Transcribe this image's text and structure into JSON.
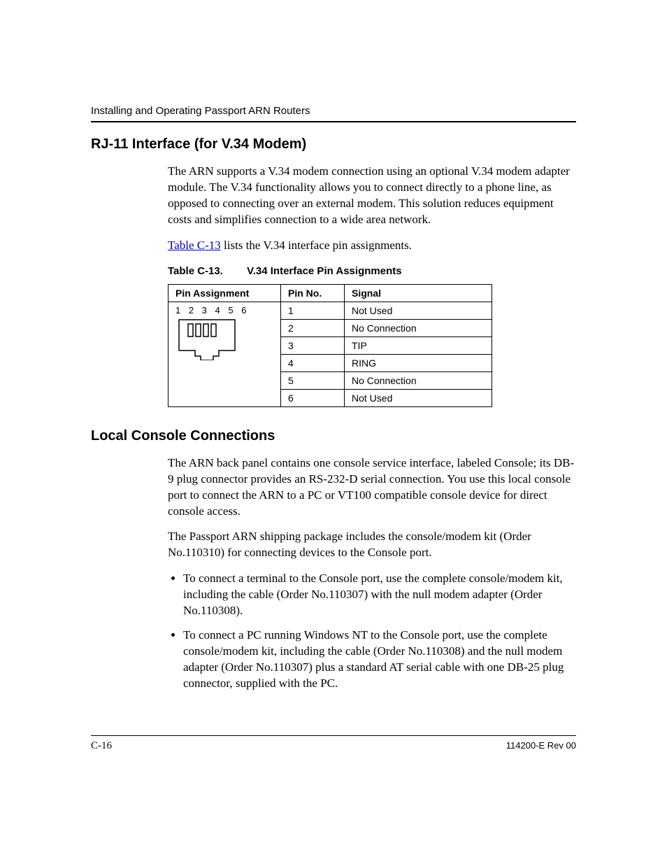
{
  "header": {
    "running_title": "Installing and Operating Passport ARN Routers"
  },
  "section1": {
    "heading": "RJ-11 Interface (for V.34 Modem)",
    "para1": "The ARN supports a V.34 modem connection using an optional V.34 modem adapter module. The V.34 functionality allows you to connect directly to a phone line, as opposed to connecting over an external modem. This solution reduces equipment costs and simplifies connection to a wide area network.",
    "para2_link": "Table C-13",
    "para2_rest": " lists the V.34 interface pin assignments.",
    "table_caption_num": "Table C-13.",
    "table_caption_title": "V.34 Interface Pin Assignments",
    "table": {
      "headers": {
        "pa": "Pin Assignment",
        "pn": "Pin No.",
        "sig": "Signal"
      },
      "diagram_label": "1 2 3 4 5 6",
      "rows": [
        {
          "pin": "1",
          "signal": "Not Used"
        },
        {
          "pin": "2",
          "signal": "No Connection"
        },
        {
          "pin": "3",
          "signal": "TIP"
        },
        {
          "pin": "4",
          "signal": "RING"
        },
        {
          "pin": "5",
          "signal": "No Connection"
        },
        {
          "pin": "6",
          "signal": "Not Used"
        }
      ]
    }
  },
  "section2": {
    "heading": "Local Console Connections",
    "para1": "The ARN back panel contains one console service interface, labeled Console; its DB-9 plug connector provides an RS-232-D serial connection. You use this local console port to connect the ARN to a PC or VT100 compatible console device for direct console access.",
    "para2": "The Passport ARN shipping package includes the console/modem kit (Order No.110310) for connecting devices to the Console port.",
    "bullets": [
      "To connect a terminal to the Console port, use the complete console/modem kit, including the cable (Order No.110307) with the null modem adapter (Order No.110308).",
      "To connect a PC running Windows NT to the Console port, use the complete console/modem kit, including the cable (Order No.110308) and the null modem adapter (Order No.110307) plus a standard AT serial cable with one DB-25 plug connector, supplied with the PC."
    ]
  },
  "footer": {
    "page": "C-16",
    "docnum": "114200-E Rev 00"
  }
}
